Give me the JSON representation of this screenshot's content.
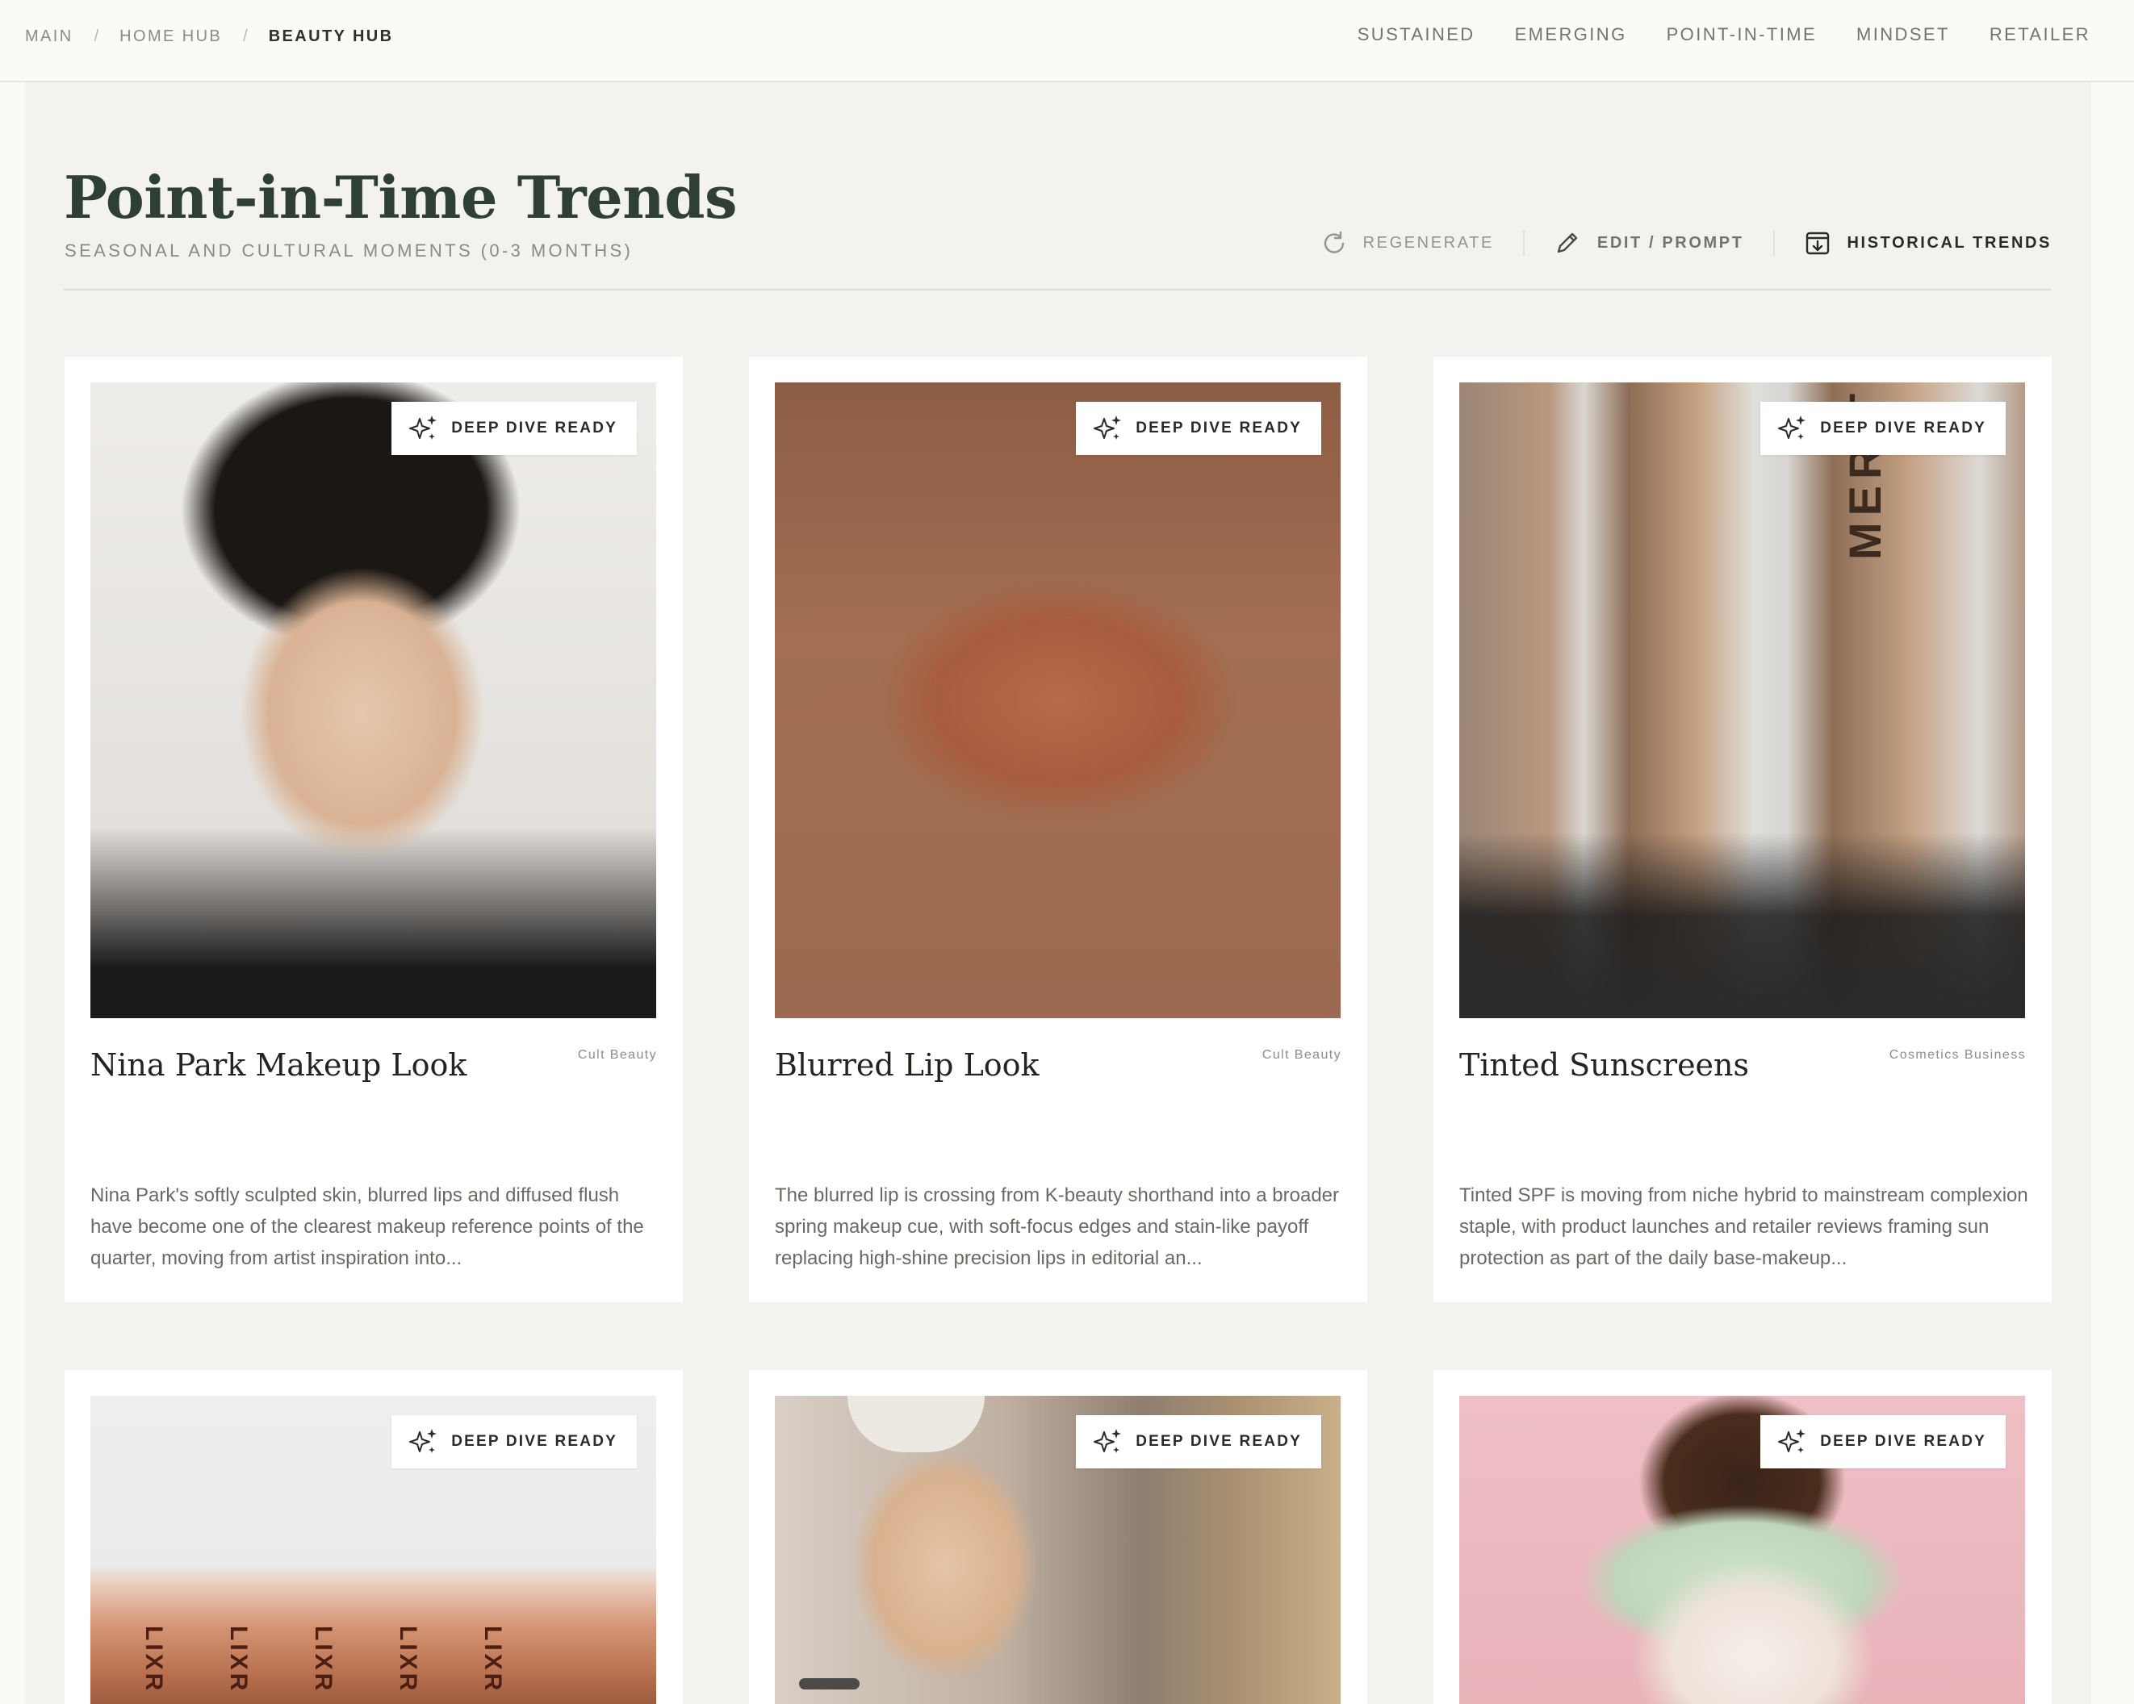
{
  "breadcrumb": [
    "MAIN",
    "HOME HUB",
    "BEAUTY HUB"
  ],
  "nav": [
    "SUSTAINED",
    "EMERGING",
    "POINT-IN-TIME",
    "MINDSET",
    "RETAILER"
  ],
  "page": {
    "title": "Point-in-Time Trends",
    "subtitle": "SEASONAL AND CULTURAL MOMENTS (0-3 MONTHS)"
  },
  "actions": {
    "regenerate": "REGENERATE",
    "edit": "EDIT / PROMPT",
    "historical": "HISTORICAL TRENDS"
  },
  "cards": [
    {
      "badge": "DEEP DIVE READY",
      "title": "Nina Park Makeup Look",
      "source": "Cult Beauty",
      "description": "Nina Park's softly sculpted skin, blurred lips and diffused flush have become one of the clearest makeup reference points of the quarter, moving from artist inspiration into...",
      "image": "woman-laughing-red-nails"
    },
    {
      "badge": "DEEP DIVE READY",
      "title": "Blurred Lip Look",
      "source": "Cult Beauty",
      "description": "The blurred lip is crossing from K-beauty shorthand into a broader spring makeup cue, with soft-focus edges and stain-like payoff replacing high-shine precision lips in editorial an...",
      "image": "closeup-terracotta-lips"
    },
    {
      "badge": "DEEP DIVE READY",
      "title": "Tinted Sunscreens",
      "source": "Cosmetics Business",
      "description": "Tinted SPF is moving from niche hybrid to mainstream complexion staple, with product launches and retailer reviews framing sun protection as part of the daily base-makeup...",
      "image": "merit-tinted-spf-tubes"
    },
    {
      "badge": "DEEP DIVE READY",
      "image": "lixr-tinted-tubes",
      "tube_label": "LIXR"
    },
    {
      "badge": "DEEP DIVE READY",
      "image": "woman-sheet-mask"
    },
    {
      "badge": "DEEP DIVE READY",
      "image": "woman-face-cleanser-headband"
    }
  ],
  "image_label": "MERIT"
}
